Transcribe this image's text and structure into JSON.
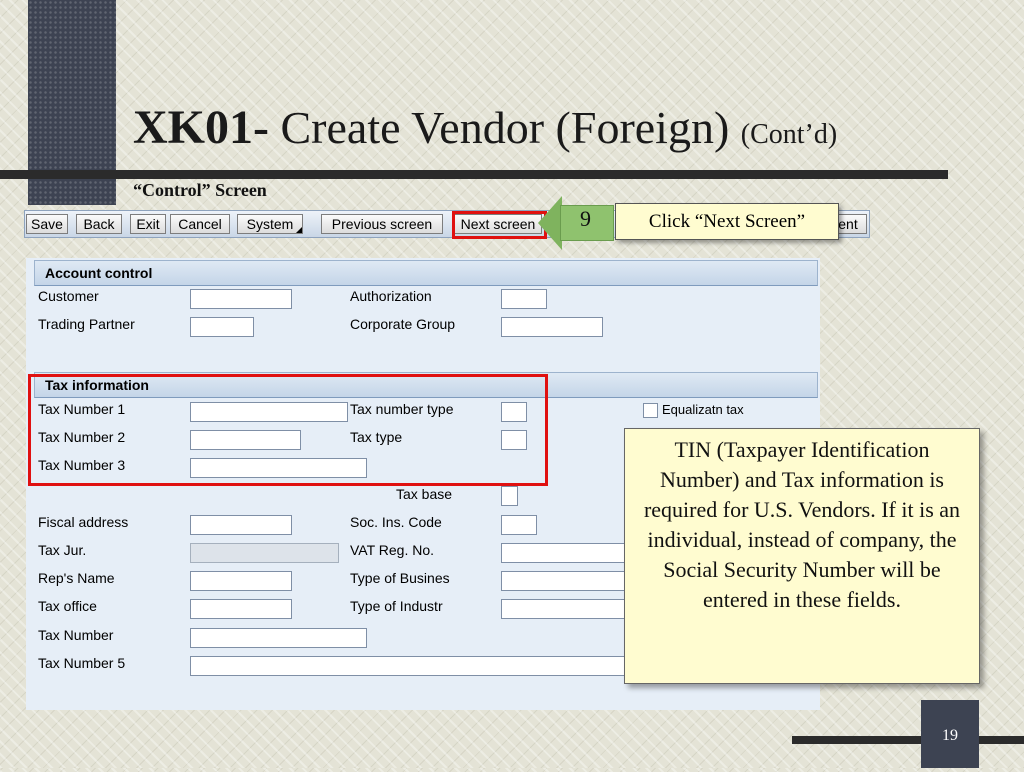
{
  "slide": {
    "title_code": "XK01-",
    "title_rest": " Create Vendor (Foreign) ",
    "title_contd": "(Cont’d)",
    "subtitle": "“Control” Screen",
    "page_number": "19"
  },
  "toolbar": {
    "save": "Save",
    "back": "Back",
    "exit": "Exit",
    "cancel": "Cancel",
    "system": "System",
    "previous_screen": "Previous screen",
    "next_screen": "Next screen",
    "partial_button": "ent"
  },
  "callout": {
    "step": "9",
    "text": "Click “Next Screen”"
  },
  "info_box": {
    "text": "TIN (Taxpayer Identification Number) and Tax information is required for U.S. Vendors.  If it is an individual, instead of company, the Social Security Number will be entered in these fields."
  },
  "account_control": {
    "header": "Account control",
    "customer": {
      "label": "Customer",
      "value": ""
    },
    "trading_partner": {
      "label": "Trading Partner",
      "value": ""
    },
    "authorization": {
      "label": "Authorization",
      "value": ""
    },
    "corporate_group": {
      "label": "Corporate Group",
      "value": ""
    }
  },
  "tax_information": {
    "header": "Tax information",
    "tax_number_1": {
      "label": "Tax Number 1",
      "value": ""
    },
    "tax_number_2": {
      "label": "Tax Number 2",
      "value": ""
    },
    "tax_number_3": {
      "label": "Tax Number 3",
      "value": ""
    },
    "tax_number_type": {
      "label": "Tax number type",
      "value": ""
    },
    "tax_type": {
      "label": "Tax type",
      "value": ""
    },
    "equalization_tax": {
      "label": "Equalizatn tax",
      "checked": false
    },
    "tax_base": {
      "label": "Tax base"
    },
    "fiscal_address": {
      "label": "Fiscal address",
      "value": ""
    },
    "tax_jur": {
      "label": "Tax Jur.",
      "value": ""
    },
    "reps_name": {
      "label": "Rep's Name",
      "value": ""
    },
    "tax_office": {
      "label": "Tax office",
      "value": ""
    },
    "tax_number": {
      "label": "Tax Number",
      "value": ""
    },
    "tax_number_5": {
      "label": "Tax Number 5",
      "value": ""
    },
    "soc_ins_code": {
      "label": "Soc. Ins. Code",
      "value": ""
    },
    "vat_reg_no": {
      "label": "VAT Reg. No.",
      "value": ""
    },
    "type_of_business": {
      "label": "Type of Busines",
      "value": ""
    },
    "type_of_industry": {
      "label": "Type of Industr",
      "value": ""
    }
  },
  "colors": {
    "highlight_red": "#e01010",
    "callout_yellow": "#fffcd0",
    "arrow_green": "#8fc26e",
    "panel_blue": "#e6eef7"
  }
}
